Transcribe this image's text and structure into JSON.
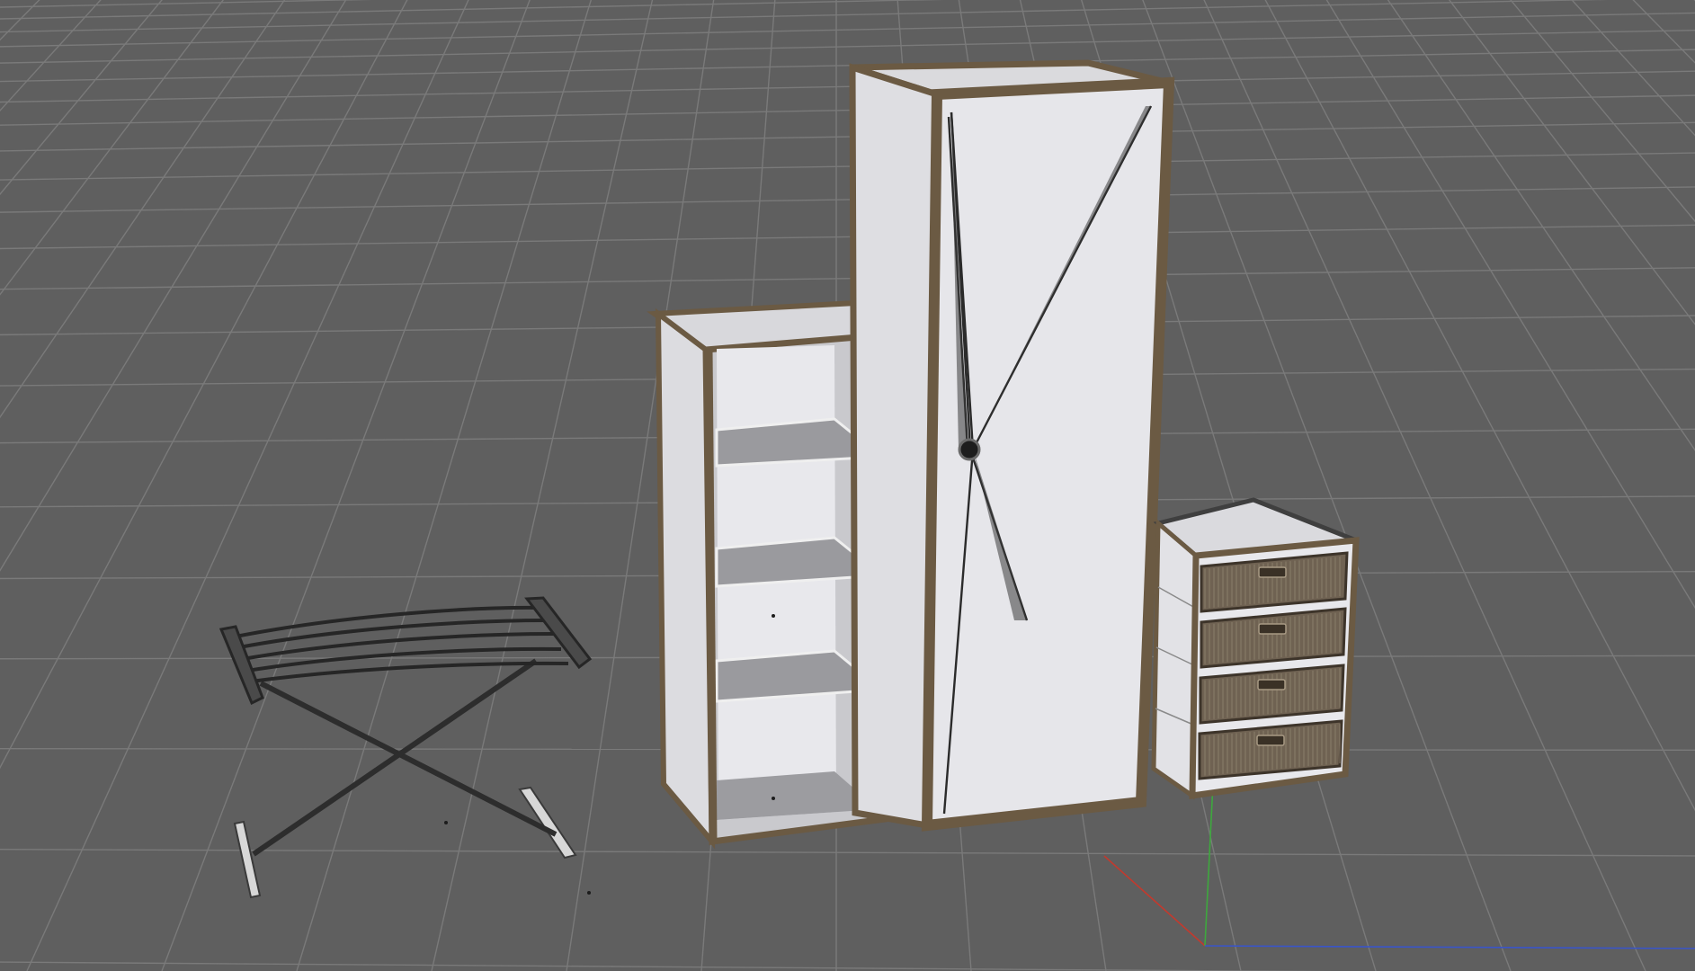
{
  "scene": {
    "background_color": "#5f5f5f",
    "grid_color": "#7a7a7a",
    "grid_major_color": "#868686",
    "frame_color": "#6b5a43",
    "panel_color": "#e6e6ea",
    "wicker_color": "#6f6252",
    "axis_x_color": "#c23a2e",
    "axis_y_color": "#3ea83e",
    "axis_z_color": "#3a55c8",
    "objects": [
      "folding-stool",
      "open-bookcase",
      "tall-wardrobe",
      "chest-of-drawers"
    ],
    "bookcase_shelf_count": 3,
    "drawer_count": 4
  }
}
